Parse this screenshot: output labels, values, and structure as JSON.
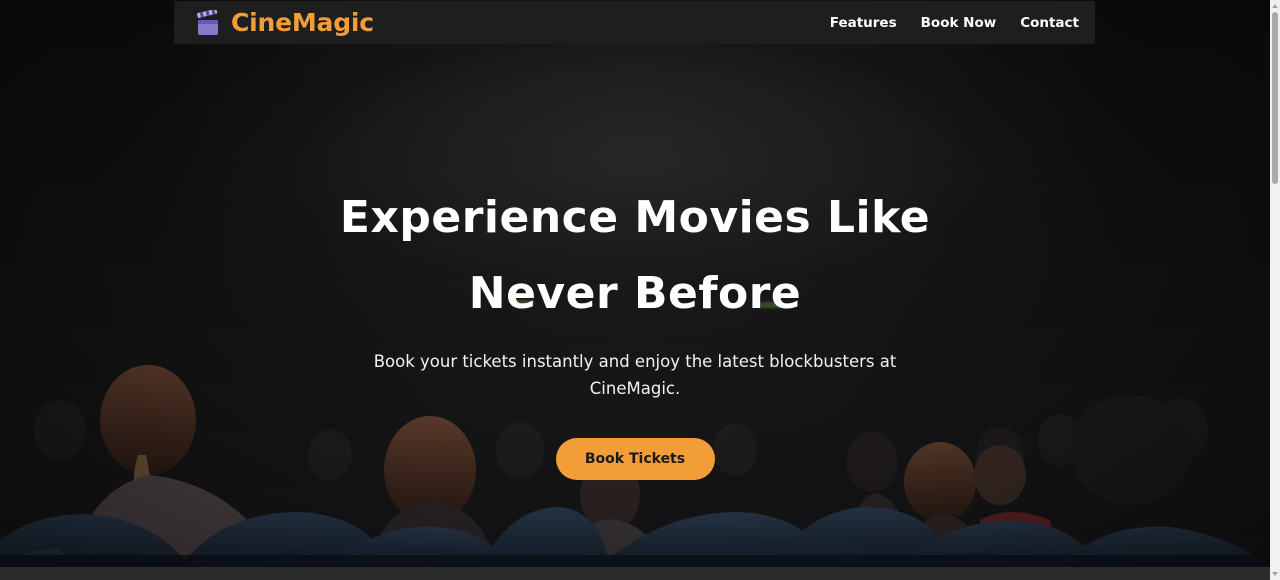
{
  "app": {
    "brand_name": "CineMagic",
    "brand_icon": "clapperboard-icon",
    "accent_color": "#f29d38",
    "navbar_bg": "#1e1e1f"
  },
  "nav": {
    "links": [
      {
        "label": "Features"
      },
      {
        "label": "Book Now"
      },
      {
        "label": "Contact"
      }
    ]
  },
  "hero": {
    "title": "Experience Movies Like Never Before",
    "subtitle": "Book your tickets instantly and enjoy the latest blockbusters at CineMagic.",
    "cta_label": "Book Tickets",
    "background": "dark cinema audience photo"
  },
  "scrollbar": {
    "icons": [
      "scroll-up-icon",
      "scroll-down-icon"
    ]
  }
}
